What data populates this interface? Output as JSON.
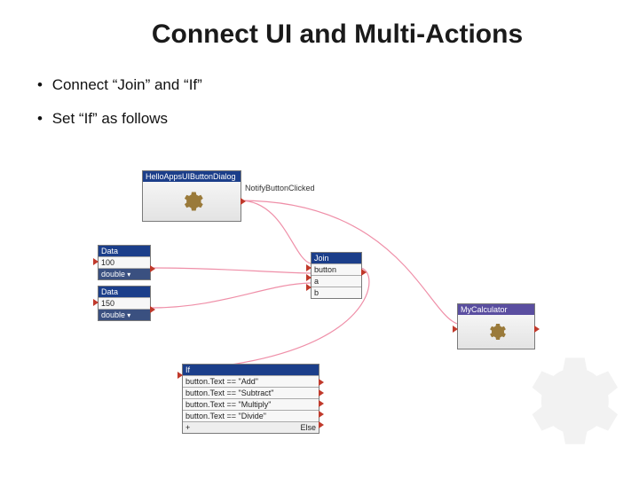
{
  "title": "Connect UI and Multi-Actions",
  "bullets": {
    "b1": "Connect “Join” and “If”",
    "b2": "Set “If” as follows"
  },
  "nodes": {
    "dialog": {
      "header": "HelloAppsUIButtonDialog",
      "outLabel": "NotifyButtonClicked"
    },
    "data1": {
      "header": "Data",
      "value": "100",
      "type": "double"
    },
    "data2": {
      "header": "Data",
      "value": "150",
      "type": "double"
    },
    "join": {
      "header": "Join",
      "r1": "button",
      "r2": "a",
      "r3": "b"
    },
    "mycalc": {
      "header": "MyCalculator"
    },
    "if": {
      "header": "If",
      "c1": "button.Text == \"Add\"",
      "c2": "button.Text == \"Subtract\"",
      "c3": "button.Text == \"Multiply\"",
      "c4": "button.Text == \"Divide\"",
      "plus": "+",
      "else": "Else"
    }
  },
  "colors": {
    "headerBg": "#1b3e8a",
    "wire": "#ef8fa8",
    "triangle": "#c0392b"
  }
}
